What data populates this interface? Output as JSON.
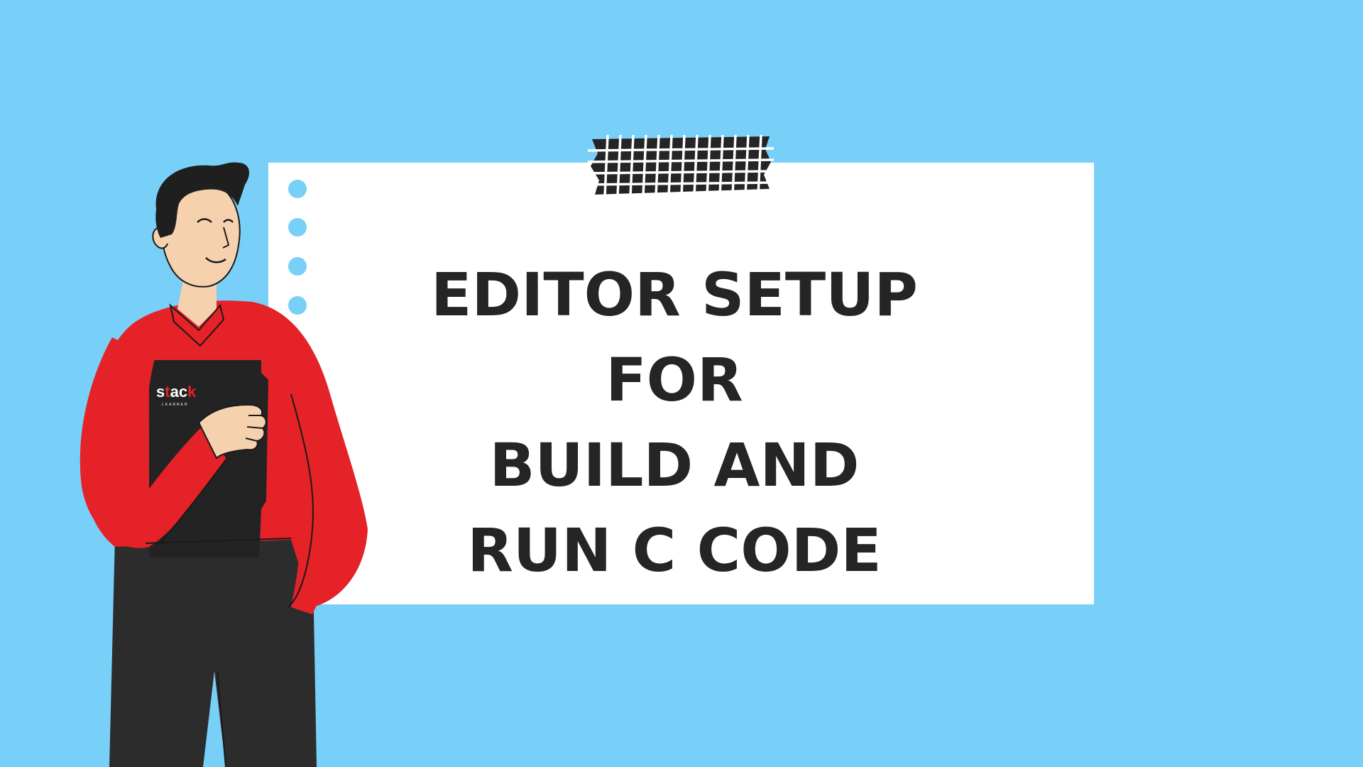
{
  "thumbnail": {
    "title_lines": [
      "EDITOR SETUP",
      "FOR",
      "BUILD AND",
      "RUN C CODE"
    ],
    "book_logo": "stack",
    "book_logo_subtext": "LEARNER"
  },
  "colors": {
    "background": "#78d0f8",
    "card": "#ffffff",
    "title_text": "#252525",
    "hole": "#78d0f8",
    "tape": "#252525",
    "sweater": "#e42227",
    "pants": "#2c2c2c",
    "hair": "#1f1f1f",
    "skin": "#f6d1ae",
    "book": "#232323",
    "logo_accent": "#e42227"
  },
  "icons": {
    "tape": "grid-tape-icon",
    "person": "person-holding-book-icon"
  }
}
